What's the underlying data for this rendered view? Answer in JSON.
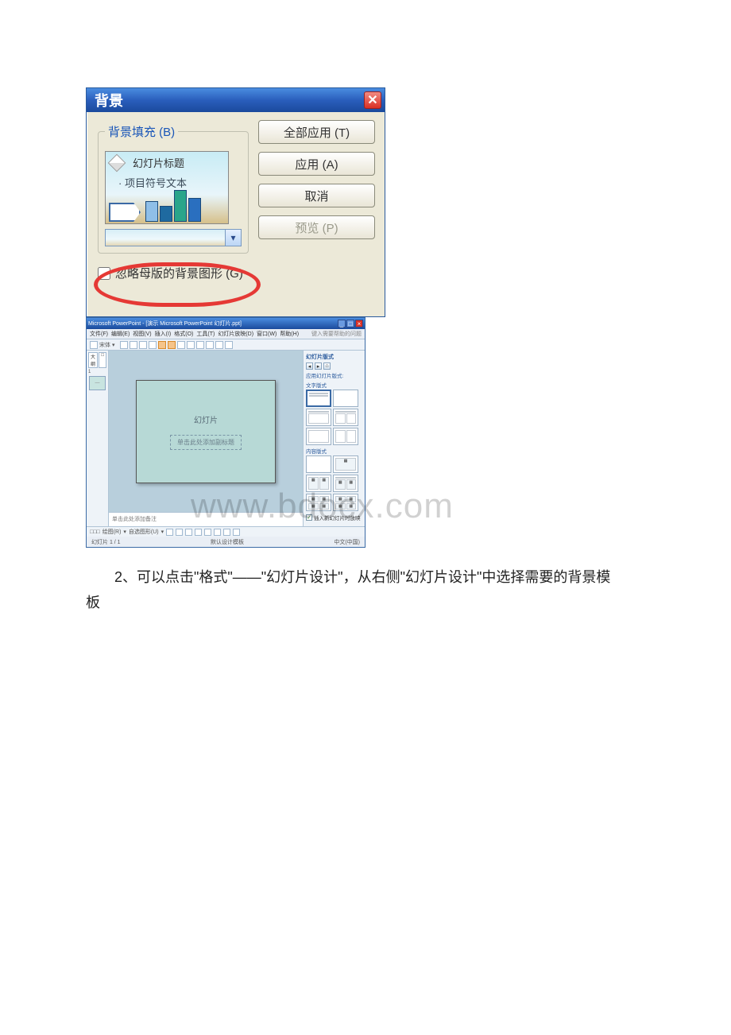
{
  "dialog": {
    "title": "背景",
    "legend": "背景填充 (B)",
    "preview": {
      "title": "幻灯片标题",
      "bullet": "· 项目符号文本"
    },
    "ignore_label": "忽略母版的背景图形 (G)",
    "buttons": {
      "apply_all": "全部应用 (T)",
      "apply": "应用 (A)",
      "cancel": "取消",
      "preview": "预览 (P)"
    }
  },
  "ppwin": {
    "title": "Microsoft PowerPoint - [演示 Microsoft PowerPoint 幻灯片.ppt]",
    "help_hint": "键入需要帮助的问题",
    "menus": [
      "文件(F)",
      "编辑(E)",
      "视图(V)",
      "插入(I)",
      "格式(O)",
      "工具(T)",
      "幻灯片放映(D)",
      "窗口(W)",
      "帮助(H)"
    ],
    "font_name": "宋体",
    "tabs": {
      "outline": "大纲",
      "slides": "□"
    },
    "thumb_index": "1",
    "slide": {
      "title": "幻灯片",
      "subtitle": "单击此处添加副标题"
    },
    "notes": "单击此处添加备注",
    "task": {
      "panel_title": "幻灯片版式",
      "apply_label": "应用幻灯片版式:",
      "sections": {
        "text": "文字版式",
        "content": "内容版式"
      },
      "footer_checkbox": "插入新幻灯片时放映"
    },
    "drawbar_label": "绘图(R)",
    "autoshape_label": "自选图形(U)",
    "viewbtns": "□□□",
    "status": {
      "left": "幻灯片 1 / 1",
      "center": "默认设计模板",
      "right": "中文(中国)"
    }
  },
  "paragraph": {
    "text_a": "2、可以点击\"格式\"——\"幻灯片设计\"，从右侧\"幻灯片设计\"中选择需要的背景模",
    "text_b": "板"
  },
  "watermark": "www.bdocx.com"
}
